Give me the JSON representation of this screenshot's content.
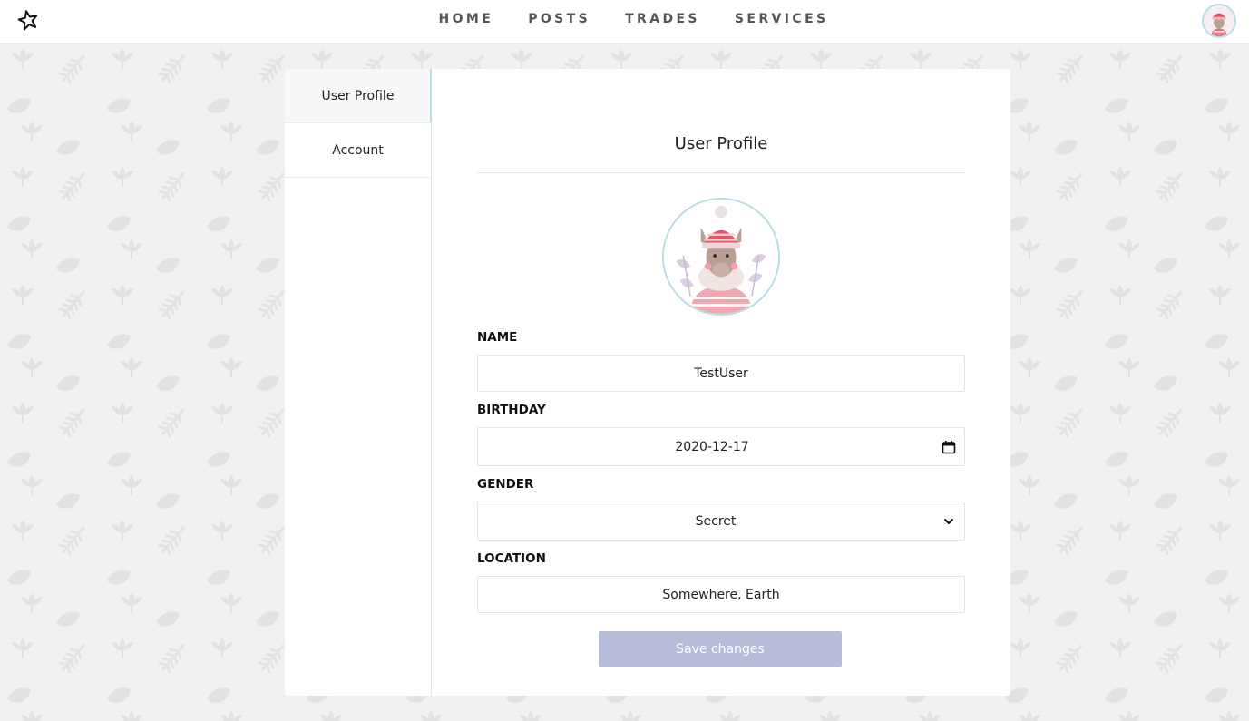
{
  "nav": {
    "items": [
      {
        "label": "HOME"
      },
      {
        "label": "POSTS"
      },
      {
        "label": "TRADES"
      },
      {
        "label": "SERVICES"
      }
    ]
  },
  "icons": {
    "logo": "star-logo-icon",
    "avatar": "llama-avatar",
    "calendar": "calendar-icon",
    "chevron": "chevron-down-icon"
  },
  "colors": {
    "accent": "#b8dde3",
    "button": "#b7bcd8",
    "background": "#f1f1f1"
  },
  "sidebar": {
    "items": [
      {
        "label": "User Profile",
        "active": true
      },
      {
        "label": "Account",
        "active": false
      }
    ]
  },
  "profile": {
    "title": "User Profile",
    "fields": {
      "name": {
        "label": "NAME",
        "value": "TestUser"
      },
      "birthday": {
        "label": "BIRTHDAY",
        "value": "2020-12-17"
      },
      "gender": {
        "label": "GENDER",
        "value": "Secret"
      },
      "location": {
        "label": "LOCATION",
        "value": "Somewhere, Earth"
      }
    },
    "save_label": "Save changes"
  }
}
